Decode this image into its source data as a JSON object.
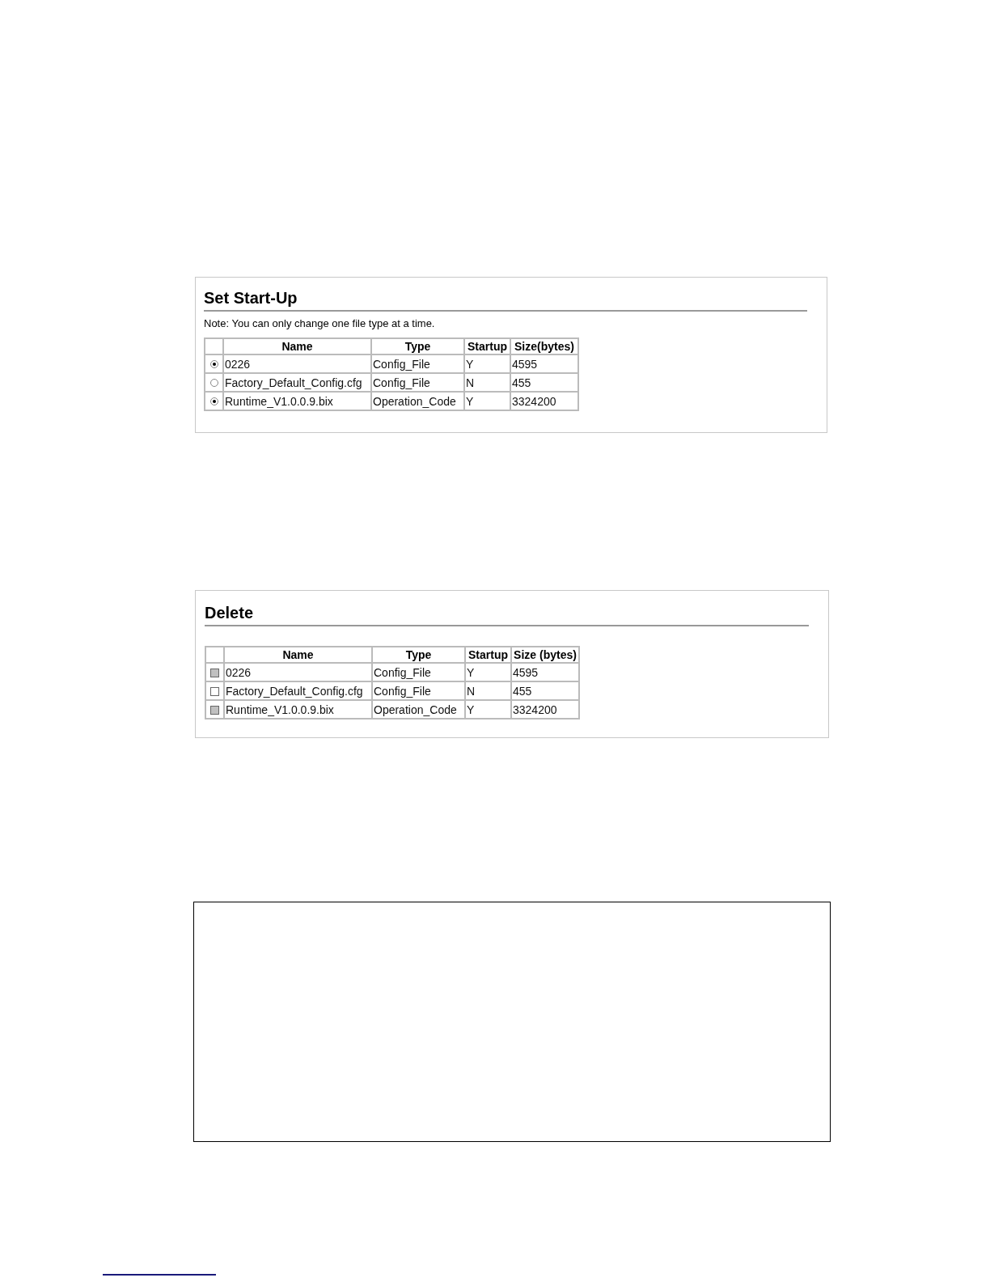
{
  "set_startup": {
    "title": "Set Start-Up",
    "note": "Note: You can only change one file type at a time.",
    "columns": [
      "Name",
      "Type",
      "Startup",
      "Size(bytes)"
    ],
    "rows": [
      {
        "selected": true,
        "cells": [
          "0226",
          "Config_File",
          "Y",
          "4595"
        ]
      },
      {
        "selected": false,
        "cells": [
          "Factory_Default_Config.cfg",
          "Config_File",
          "N",
          "455"
        ]
      },
      {
        "selected": true,
        "cells": [
          "Runtime_V1.0.0.9.bix",
          "Operation_Code",
          "Y",
          "3324200"
        ]
      }
    ]
  },
  "delete": {
    "title": "Delete",
    "columns": [
      "Name",
      "Type",
      "Startup",
      "Size (bytes)"
    ],
    "rows": [
      {
        "disabled": true,
        "cells": [
          "0226",
          "Config_File",
          "Y",
          "4595"
        ]
      },
      {
        "disabled": false,
        "cells": [
          "Factory_Default_Config.cfg",
          "Config_File",
          "N",
          "455"
        ]
      },
      {
        "disabled": true,
        "cells": [
          "Runtime_V1.0.0.9.bix",
          "Operation_Code",
          "Y",
          "3324200"
        ]
      }
    ]
  }
}
